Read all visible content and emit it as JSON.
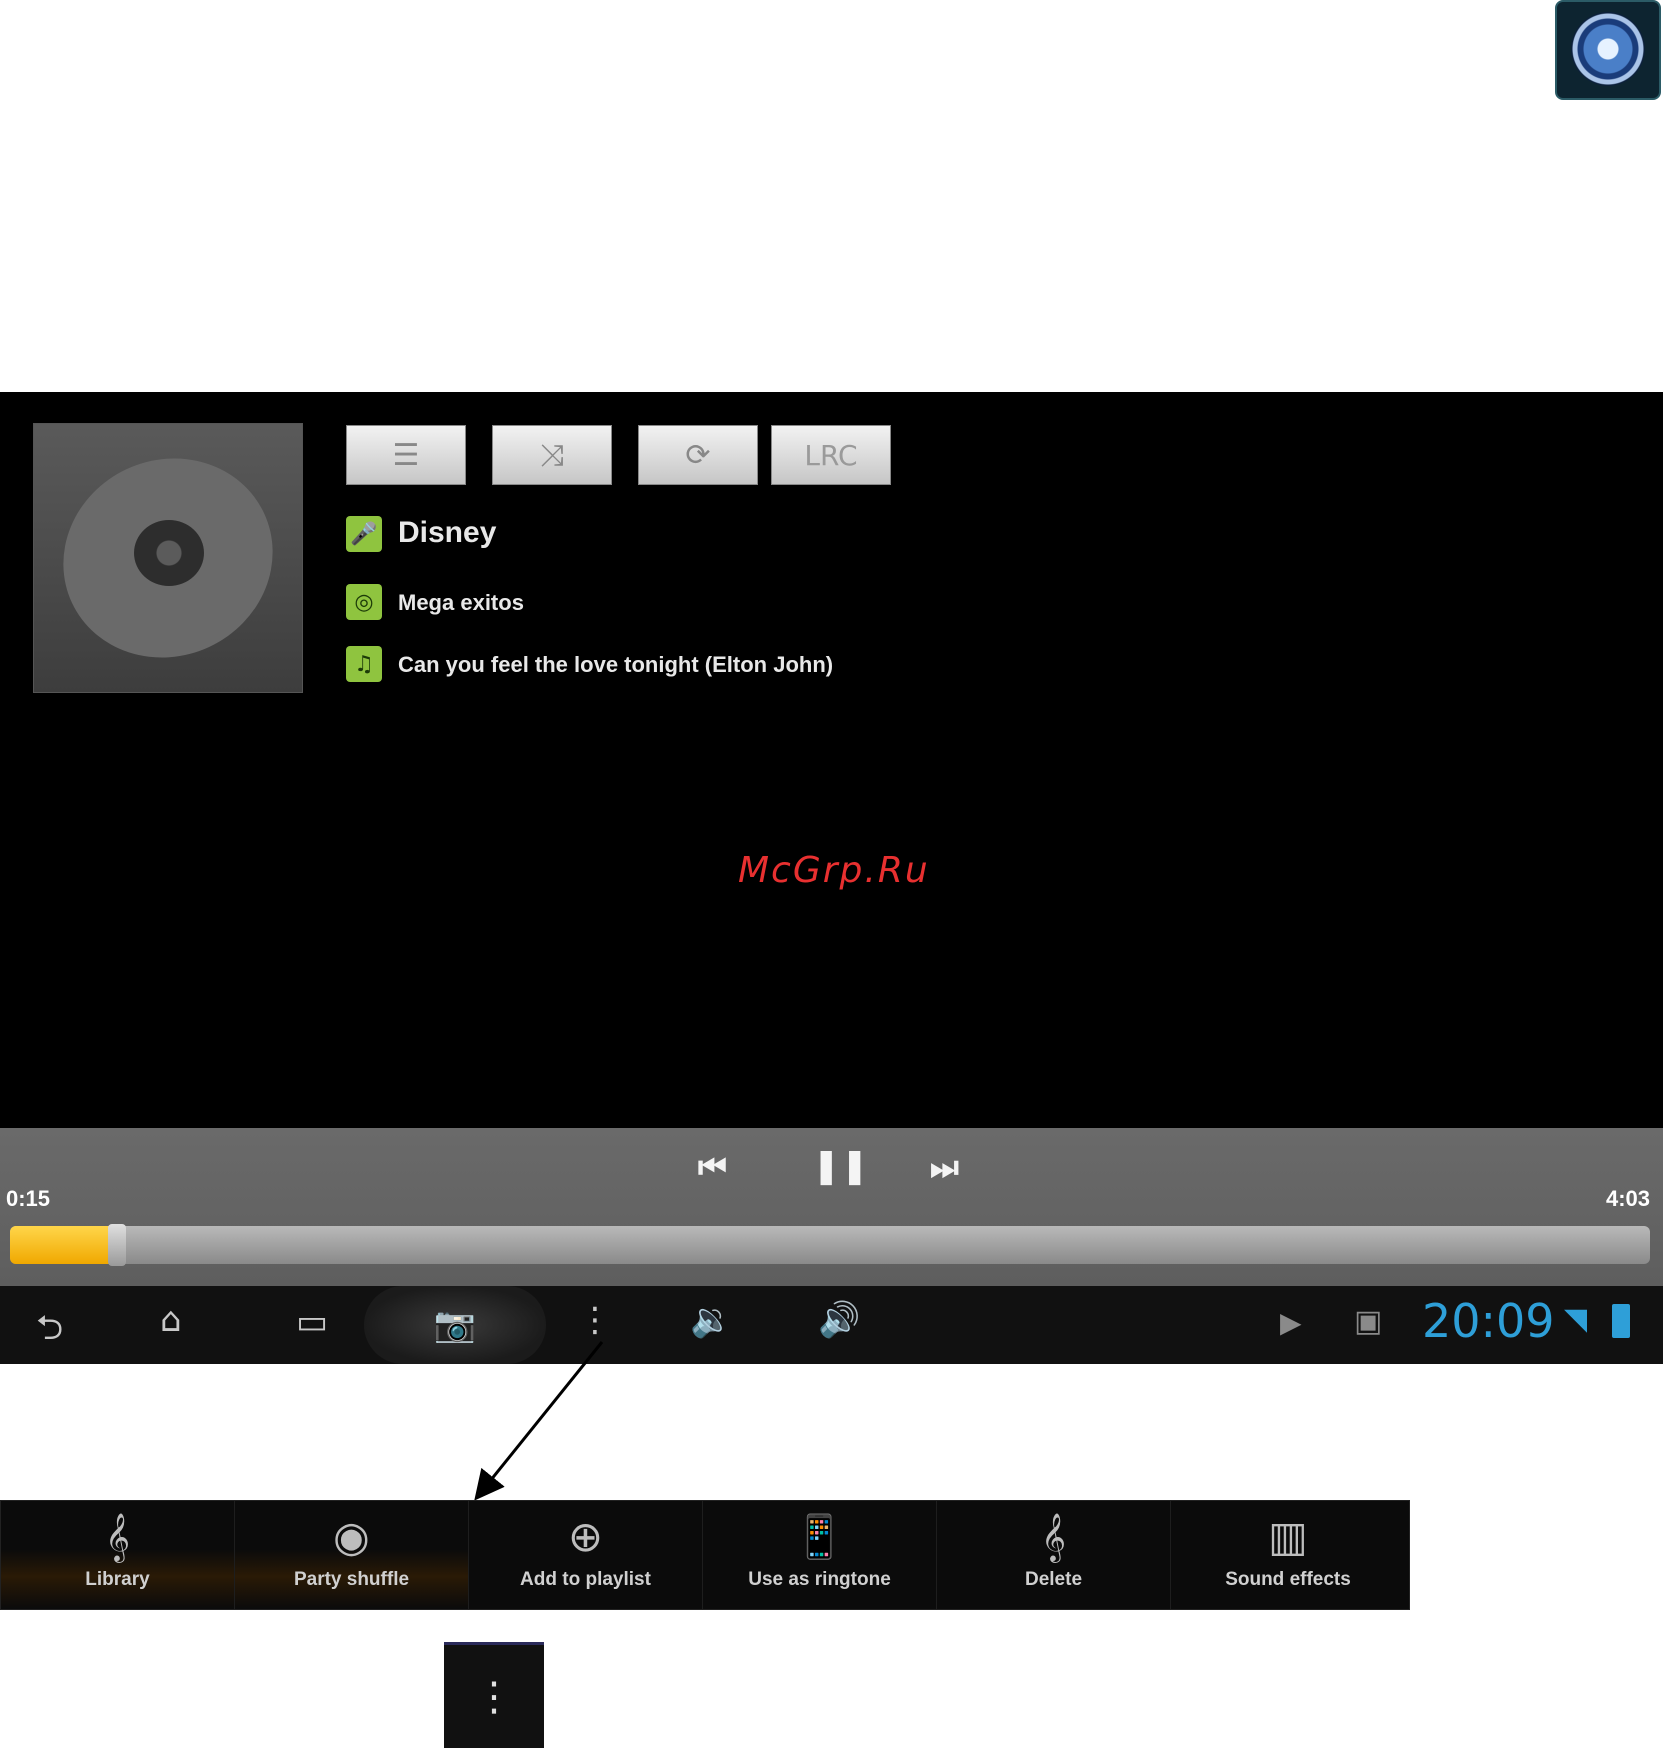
{
  "player": {
    "toolbar": {
      "lrc_label": "LRC"
    },
    "track_info": {
      "artist": "Disney",
      "album": "Mega exitos",
      "title": "Can you feel the love tonight (Elton John)"
    },
    "watermark": "McGrp.Ru",
    "progress": {
      "elapsed": "0:15",
      "total": "4:03",
      "fraction": 0.062
    }
  },
  "system_bar": {
    "clock": "20:09"
  },
  "overflow_menu": {
    "items": [
      {
        "label": "Library",
        "icon": "library-icon"
      },
      {
        "label": "Party shuffle",
        "icon": "party-shuffle-icon"
      },
      {
        "label": "Add to playlist",
        "icon": "add-icon"
      },
      {
        "label": "Use as ringtone",
        "icon": "ringtone-icon"
      },
      {
        "label": "Delete",
        "icon": "delete-icon"
      },
      {
        "label": "Sound effects",
        "icon": "equalizer-icon"
      }
    ]
  },
  "colors": {
    "progress_fill": "#f5b800",
    "clock": "#2e9fd8",
    "info_icon": "#8fc43f",
    "watermark": "#e83030"
  }
}
